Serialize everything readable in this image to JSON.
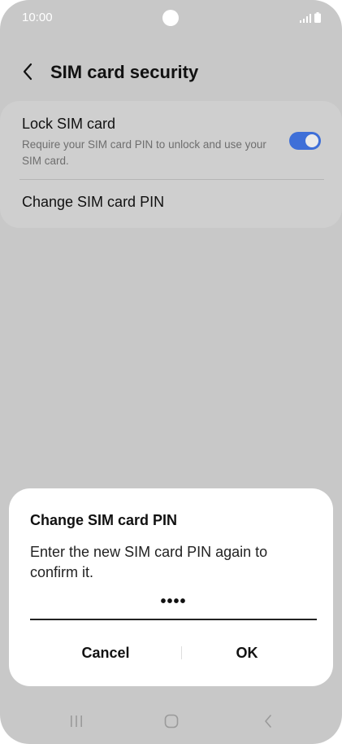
{
  "status_bar": {
    "time": "10:00"
  },
  "header": {
    "title": "SIM card security"
  },
  "settings": {
    "lock_sim": {
      "title": "Lock SIM card",
      "subtitle": "Require your SIM card PIN to unlock and use your SIM card.",
      "enabled": true
    },
    "change_pin": {
      "title": "Change SIM card PIN"
    }
  },
  "dialog": {
    "title": "Change SIM card PIN",
    "message": "Enter the new SIM card PIN again to confirm it.",
    "pin_value": "••••",
    "cancel_label": "Cancel",
    "ok_label": "OK"
  },
  "colors": {
    "accent": "#3e6fd8",
    "background_dim": "#c8c8c8",
    "dialog_bg": "#ffffff"
  },
  "icons": {
    "back": "chevron-left-icon",
    "signal": "signal-icon",
    "battery": "battery-icon",
    "recent": "recent-apps-icon",
    "home": "home-icon",
    "nav_back": "nav-back-icon"
  }
}
